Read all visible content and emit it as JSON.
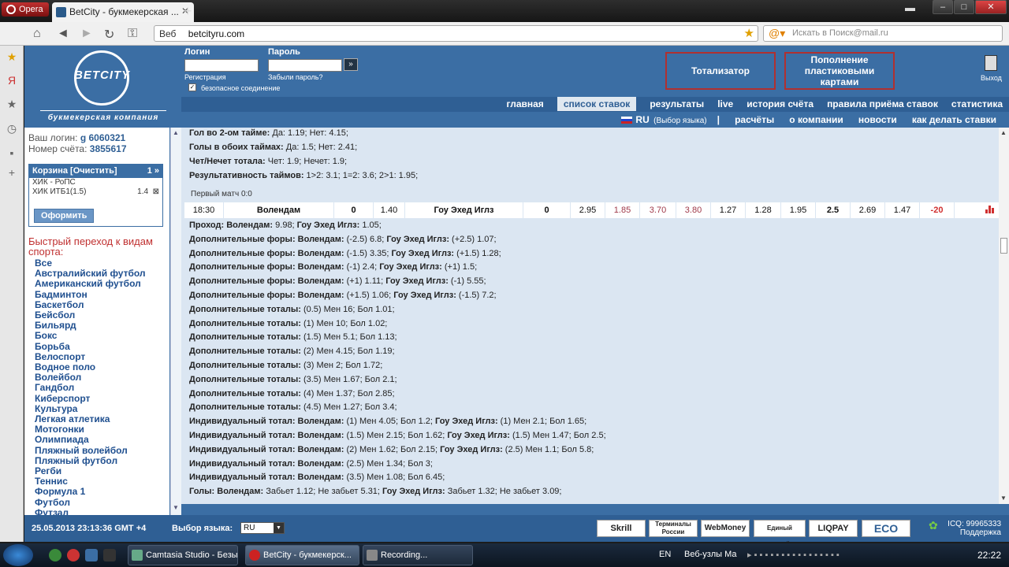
{
  "browser": {
    "opera_label": "Opera",
    "tab_title": "BetCity - букмекерская ...",
    "url_prefix": "Веб",
    "url": "betcityru.com",
    "search_placeholder": "Искать в Поиск@mail.ru"
  },
  "header": {
    "logo_text": "BETCITY",
    "logo_tagline": "букмекерская компания",
    "login_label": "Логин",
    "password_label": "Пароль",
    "register_link": "Регистрация",
    "forgot_link": "Забыли пароль?",
    "secure_label": "безопасное соединение",
    "totalizator_btn": "Тотализатор",
    "topup_btn": "Пополнение пластиковыми картами",
    "exit_label": "Выход"
  },
  "menu1": [
    "главная",
    "список ставок",
    "результаты",
    "live",
    "история счёта",
    "правила приёма ставок",
    "статистика"
  ],
  "menu2": {
    "lang": "RU",
    "lang_hint": "(Выбор языка)",
    "items": [
      "расчёты",
      "о компании",
      "новости",
      "как делать ставки"
    ]
  },
  "account": {
    "login_label": "Ваш логин:",
    "login_value": "g 6060321",
    "account_label": "Номер счёта:",
    "account_value": "3855617"
  },
  "cart": {
    "title": "Корзина [Очистить]",
    "count": "1 »",
    "items": [
      {
        "name": "ХИК - РоПС",
        "value": ""
      },
      {
        "name": "ХИК ИТБ1(1.5)",
        "value": "1.4"
      }
    ],
    "order_btn": "Оформить"
  },
  "quick_nav_title": "Быстрый переход к видам спорта:",
  "sports": [
    "Все",
    "Австралийский футбол",
    "Американский футбол",
    "Бадминтон",
    "Баскетбол",
    "Бейсбол",
    "Бильярд",
    "Бокс",
    "Борьба",
    "Велоспорт",
    "Водное поло",
    "Волейбол",
    "Гандбол",
    "Киберспорт",
    "Культура",
    "Легкая атлетика",
    "Мотогонки",
    "Олимпиада",
    "Пляжный волейбол",
    "Пляжный футбол",
    "Регби",
    "Теннис",
    "Формула 1",
    "Футбол",
    "Футзал"
  ],
  "top_lines": [
    {
      "label": "Гол во 2-ом тайме:",
      "text": " Да: 1.19; Нет: 4.15;"
    },
    {
      "label": "Голы в обоих таймах:",
      "text": " Да: 1.5; Нет: 2.41;"
    },
    {
      "label": "Чет/Нечет тотала:",
      "text": " Чет: 1.9; Нечет: 1.9;"
    },
    {
      "label": "Результативность таймов:",
      "text": " 1>2: 3.1; 1=2: 3.6; 2>1: 1.95;"
    }
  ],
  "first_match": "Первый матч 0:0",
  "event": {
    "time": "18:30",
    "team1": "Волендам",
    "fora1": "0",
    "odd1": "1.40",
    "team2": "Гоу Эхед Иглз",
    "fora2": "0",
    "odds": [
      "2.95",
      "1.85",
      "3.70",
      "3.80",
      "1.27",
      "1.28",
      "1.95",
      "2.5",
      "2.69",
      "1.47",
      "-20"
    ]
  },
  "lines": [
    {
      "parts": [
        [
          "b",
          "Проход:"
        ],
        [
          "b",
          " Волендам:"
        ],
        [
          "t",
          " 9.98;"
        ],
        [
          "b",
          " Гоу Эхед Иглз:"
        ],
        [
          "t",
          " 1.05;"
        ]
      ]
    },
    {
      "parts": [
        [
          "b",
          "Дополнительные форы:"
        ],
        [
          "b",
          " Волендам:"
        ],
        [
          "t",
          " (-2.5) 6.8;"
        ],
        [
          "b",
          " Гоу Эхед Иглз:"
        ],
        [
          "t",
          " (+2.5) 1.07;"
        ]
      ]
    },
    {
      "parts": [
        [
          "b",
          "Дополнительные форы:"
        ],
        [
          "b",
          " Волендам:"
        ],
        [
          "t",
          " (-1.5) 3.35;"
        ],
        [
          "b",
          " Гоу Эхед Иглз:"
        ],
        [
          "t",
          " (+1.5) 1.28;"
        ]
      ]
    },
    {
      "parts": [
        [
          "b",
          "Дополнительные форы:"
        ],
        [
          "b",
          " Волендам:"
        ],
        [
          "t",
          " (-1) 2.4;"
        ],
        [
          "b",
          " Гоу Эхед Иглз:"
        ],
        [
          "t",
          " (+1) 1.5;"
        ]
      ]
    },
    {
      "parts": [
        [
          "b",
          "Дополнительные форы:"
        ],
        [
          "b",
          " Волендам:"
        ],
        [
          "t",
          " (+1) 1.11;"
        ],
        [
          "b",
          " Гоу Эхед Иглз:"
        ],
        [
          "t",
          " (-1) 5.55;"
        ]
      ]
    },
    {
      "parts": [
        [
          "b",
          "Дополнительные форы:"
        ],
        [
          "b",
          " Волендам:"
        ],
        [
          "t",
          " (+1.5) 1.06;"
        ],
        [
          "b",
          " Гоу Эхед Иглз:"
        ],
        [
          "t",
          " (-1.5) 7.2;"
        ]
      ]
    },
    {
      "parts": [
        [
          "b",
          "Дополнительные тоталы:"
        ],
        [
          "t",
          " (0.5) Мен 16; Бол 1.01;"
        ]
      ]
    },
    {
      "parts": [
        [
          "b",
          "Дополнительные тоталы:"
        ],
        [
          "t",
          " (1) Мен 10; Бол 1.02;"
        ]
      ]
    },
    {
      "parts": [
        [
          "b",
          "Дополнительные тоталы:"
        ],
        [
          "t",
          " (1.5) Мен 5.1; Бол 1.13;"
        ]
      ]
    },
    {
      "parts": [
        [
          "b",
          "Дополнительные тоталы:"
        ],
        [
          "t",
          " (2) Мен 4.15; Бол 1.19;"
        ]
      ]
    },
    {
      "parts": [
        [
          "b",
          "Дополнительные тоталы:"
        ],
        [
          "t",
          " (3) Мен 2; Бол 1.72;"
        ]
      ]
    },
    {
      "parts": [
        [
          "b",
          "Дополнительные тоталы:"
        ],
        [
          "t",
          " (3.5) Мен 1.67; Бол 2.1;"
        ]
      ]
    },
    {
      "parts": [
        [
          "b",
          "Дополнительные тоталы:"
        ],
        [
          "t",
          " (4) Мен 1.37; Бол 2.85;"
        ]
      ]
    },
    {
      "parts": [
        [
          "b",
          "Дополнительные тоталы:"
        ],
        [
          "t",
          " (4.5) Мен 1.27; Бол 3.4;"
        ]
      ]
    },
    {
      "parts": [
        [
          "b",
          "Индивидуальный тотал:"
        ],
        [
          "b",
          " Волендам:"
        ],
        [
          "t",
          " (1) Мен 4.05; Бол 1.2;"
        ],
        [
          "b",
          " Гоу Эхед Иглз:"
        ],
        [
          "t",
          " (1) Мен 2.1; Бол 1.65;"
        ]
      ]
    },
    {
      "parts": [
        [
          "b",
          "Индивидуальный тотал:"
        ],
        [
          "b",
          " Волендам:"
        ],
        [
          "t",
          " (1.5) Мен 2.15; Бол 1.62;"
        ],
        [
          "b",
          " Гоу Эхед Иглз:"
        ],
        [
          "t",
          " (1.5) Мен 1.47; Бол 2.5;"
        ]
      ]
    },
    {
      "parts": [
        [
          "b",
          "Индивидуальный тотал:"
        ],
        [
          "b",
          " Волендам:"
        ],
        [
          "t",
          " (2) Мен 1.62; Бол 2.15;"
        ],
        [
          "b",
          " Гоу Эхед Иглз:"
        ],
        [
          "t",
          " (2.5) Мен 1.1; Бол 5.8;"
        ]
      ]
    },
    {
      "parts": [
        [
          "b",
          "Индивидуальный тотал:"
        ],
        [
          "b",
          " Волендам:"
        ],
        [
          "t",
          " (2.5) Мен 1.34; Бол 3;"
        ]
      ]
    },
    {
      "parts": [
        [
          "b",
          "Индивидуальный тотал:"
        ],
        [
          "b",
          " Волендам:"
        ],
        [
          "t",
          " (3.5) Мен 1.08; Бол 6.45;"
        ]
      ]
    },
    {
      "parts": [
        [
          "b",
          "Голы:"
        ],
        [
          "b",
          " Волендам:"
        ],
        [
          "t",
          " Забьет 1.12; Не забьет 5.31;"
        ],
        [
          "b",
          " Гоу Эхед Иглз:"
        ],
        [
          "t",
          " Забьет 1.32; Не забьет 3.09;"
        ]
      ]
    }
  ],
  "footer": {
    "datetime": "25.05.2013  23:13:36  GMT +4",
    "lang_label": "Выбор языка:",
    "lang_value": "RU",
    "payments": [
      "Skrill",
      "Терминалы России",
      "WebMoney",
      "Единый кошелёк",
      "LIQPAY",
      "ECO"
    ],
    "icq": "ICQ: 99965333",
    "support": "Поддержка"
  },
  "taskbar": {
    "tasks": [
      "Camtasia Studio - Безы...",
      "BetCity - букмекерск...",
      "Recording..."
    ],
    "lang": "EN",
    "folder": "Веб-узлы Ма",
    "clock": "22:22"
  }
}
